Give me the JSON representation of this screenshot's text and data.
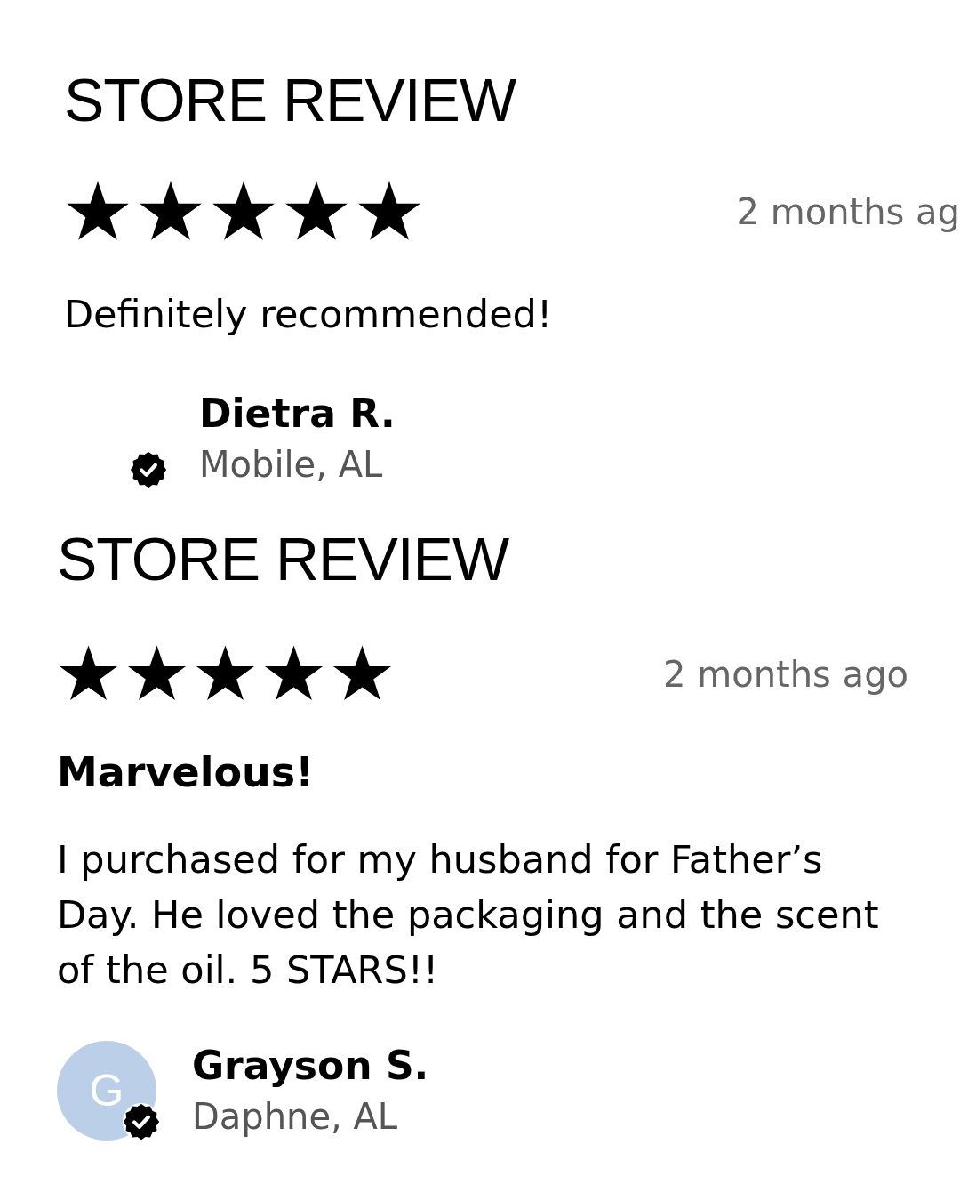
{
  "reviews": [
    {
      "heading": "STORE REVIEW",
      "stars": 5,
      "date": "2 months ag",
      "body": "Definitely recommended!",
      "name": "Dietra R.",
      "location": "Mobile, AL",
      "verified": true
    },
    {
      "heading": "STORE REVIEW",
      "stars": 5,
      "date": "2 months ago",
      "title": "Marvelous!",
      "body": "I purchased for my husband for Father’s Day. He loved the packaging and the scent of the oil. 5 STARS!!",
      "name": "Grayson S.",
      "location": "Daphne, AL",
      "avatar": {
        "initial": "G",
        "color": "#bccfe9"
      },
      "verified": true
    }
  ]
}
